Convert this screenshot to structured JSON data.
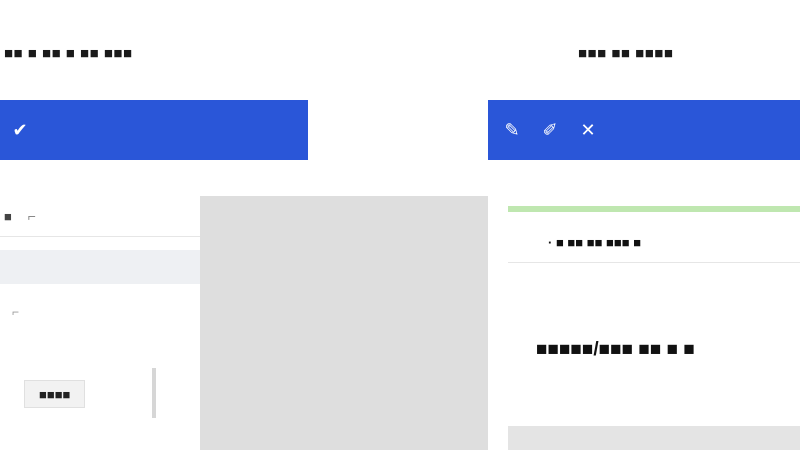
{
  "left_window": {
    "title": "■■ ■ ■■ ■ ■■ ■■■",
    "toolbar_icons": [
      {
        "name": "check-icon",
        "glyph": "✔"
      }
    ],
    "subtitle": "",
    "field_label": "■",
    "field_toggle_glyph": "⌐",
    "option_label": "",
    "option_toggle_glyph": "⌐",
    "bottom_button_label": "■■■■"
  },
  "right_window": {
    "title": "■■■ ■■ ■■■■",
    "toolbar_icons": [
      {
        "name": "edit-icon",
        "glyph": "✎"
      },
      {
        "name": "pencil-icon",
        "glyph": "✐"
      },
      {
        "name": "cross-icon",
        "glyph": "✕"
      }
    ],
    "breadcrumb": "· ■ ■■ ■■ ■■■ ■",
    "headline": "■■■■■/■■■ ■■ ■ ■",
    "faint_line_1": "",
    "faint_line_2": ""
  },
  "colors": {
    "accent_blue": "#2a56d8",
    "gap_grey": "#dedede",
    "green_strip": "#bfe7b0"
  }
}
